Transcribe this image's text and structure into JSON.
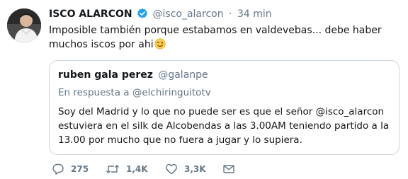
{
  "tweet": {
    "author_name": "ISCO ALARCON",
    "author_handle": "@isco_alarcon",
    "separator": "·",
    "time": "34 min",
    "text": "Imposible también porque estabamos en valdevebas... debe haber muchos iscos por ahi",
    "emoji": "winking-face",
    "verified_color": "#1da1f2"
  },
  "quoted_tweet": {
    "author_name": "ruben gala perez",
    "author_handle": "@galanpe",
    "reply_prefix": "En respuesta a",
    "reply_to": "@elchiringuitotv",
    "text": "Soy del Madrid y lo que no puede ser es que el señor @isco_alarcon estuviera en el silk de Alcobendas a las 3.00AM teniendo partido a la 13.00 por mucho que no fuera a jugar y lo supiera."
  },
  "actions": {
    "reply_count": "275",
    "retweet_count": "1,4K",
    "like_count": "3,3K",
    "icons": [
      "reply-icon",
      "retweet-icon",
      "like-icon",
      "direct-message-icon"
    ]
  },
  "colors": {
    "text": "#14171a",
    "muted": "#657786",
    "border": "#ccd6dd",
    "accent": "#1da1f2"
  }
}
